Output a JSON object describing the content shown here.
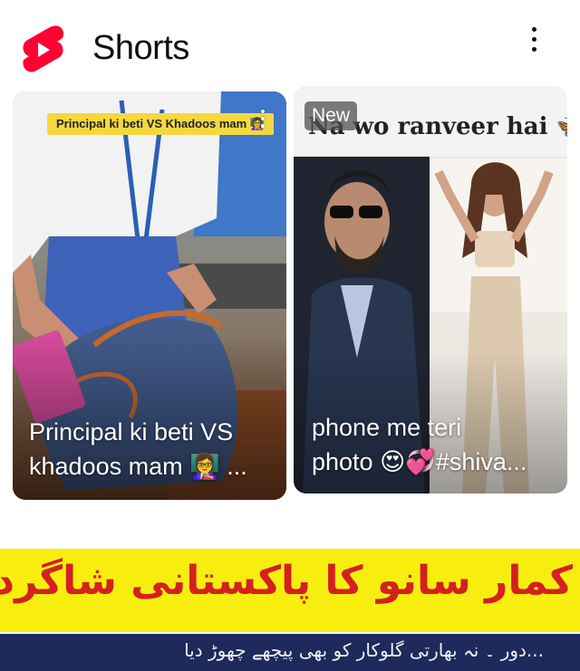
{
  "header": {
    "title": "Shorts",
    "logo_icon": "youtube-shorts-logo-icon",
    "menu_icon": "more-vert-icon"
  },
  "cards": [
    {
      "overlay_tag": "Principal ki beti VS Khadoos mam 👩‍🏫",
      "caption_line1": "Principal ki beti VS",
      "caption_line2": "khadoos mam 👩‍🏫 ...",
      "menu_icon": "more-vert-icon"
    },
    {
      "badge": "New",
      "headline": "Na wo ranveer hai 🦋",
      "caption_line1": "phone me teri",
      "caption_line2": "photo 😍💞#shiva..."
    }
  ],
  "banner": {
    "text": "کمار سانو کا پاکستانی شاگرد مزدوری کرنے پر مجبور!",
    "subtext": "...دور ۔ نہ بھارتی گلوکار کو بھی پیچھے چھوڑ دیا"
  },
  "colors": {
    "brand_red": "#ff0033",
    "banner_yellow": "#f7ee10",
    "banner_red": "#d42020"
  }
}
